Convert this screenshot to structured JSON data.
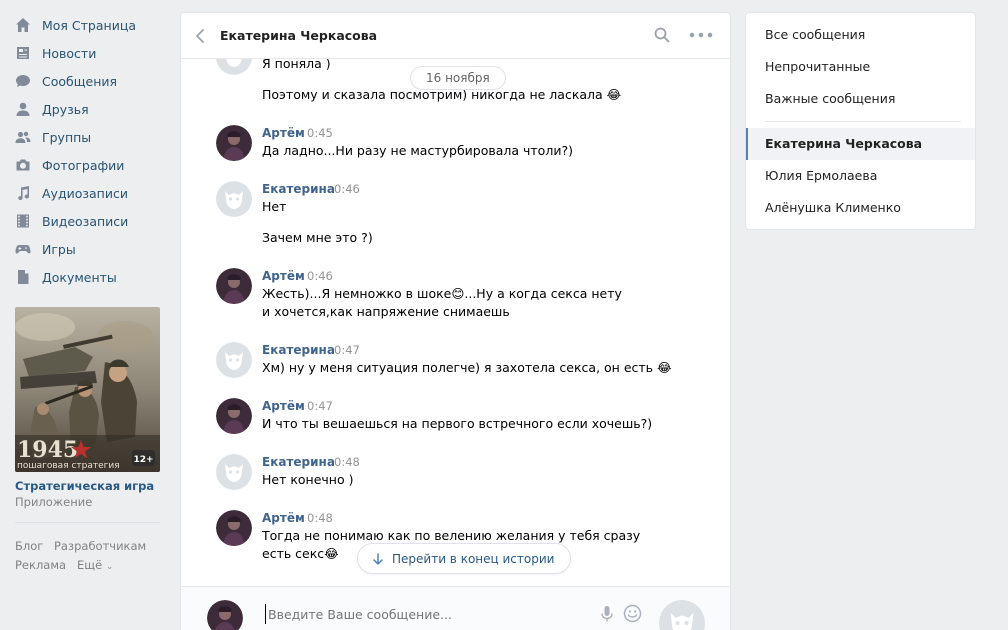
{
  "nav": {
    "items": [
      {
        "label": "Моя Страница",
        "icon": "home-icon"
      },
      {
        "label": "Новости",
        "icon": "news-icon"
      },
      {
        "label": "Сообщения",
        "icon": "messages-icon"
      },
      {
        "label": "Друзья",
        "icon": "friends-icon"
      },
      {
        "label": "Группы",
        "icon": "groups-icon"
      },
      {
        "label": "Фотографии",
        "icon": "camera-icon"
      },
      {
        "label": "Аудиозаписи",
        "icon": "music-icon"
      },
      {
        "label": "Видеозаписи",
        "icon": "video-icon"
      },
      {
        "label": "Игры",
        "icon": "gamepad-icon"
      },
      {
        "label": "Документы",
        "icon": "document-icon"
      }
    ]
  },
  "promo": {
    "game_title": "1945",
    "game_subtitle": "пошаговая стратегия",
    "age_badge": "12+",
    "title": "Стратегическая игра",
    "subtitle": "Приложение"
  },
  "footer": {
    "blog": "Блог",
    "developers": "Разработчикам",
    "ads": "Реклама",
    "more": "Ещё"
  },
  "chat": {
    "title": "Екатерина Черкасова",
    "date_pill": "16 ноября",
    "goto_end": "Перейти в конец истории",
    "input_placeholder": "Введите Ваше сообщение...",
    "messages": [
      {
        "text": "Я поняла )"
      },
      {
        "text": "Поэтому и сказала посмотрим) никогда не ласкала 😂"
      },
      {
        "author": "Артём",
        "time": "0:45",
        "text": "Да ладно...Ни разу не мастурбировала чтоли?)"
      },
      {
        "author": "Екатерина",
        "time": "0:46",
        "text": "Нет"
      },
      {
        "text": "Зачем мне это ?)"
      },
      {
        "author": "Артём",
        "time": "0:46",
        "text": "Жесть)...Я немножко в шоке😊...Ну а когда секса нету и хочется,как напряжение снимаешь"
      },
      {
        "author": "Екатерина",
        "time": "0:47",
        "text": "Хм) ну у меня ситуация полегче) я захотела секса, он есть 😂"
      },
      {
        "author": "Артём",
        "time": "0:47",
        "text": "И что ты вешаешься на первого встречного если хочешь?)"
      },
      {
        "author": "Екатерина",
        "time": "0:48",
        "text": "Нет конечно )"
      },
      {
        "author": "Артём",
        "time": "0:48",
        "text": "Тогда не понимаю как по велению желания у тебя сразу есть секс😂"
      }
    ]
  },
  "sidebar": {
    "filters": [
      "Все сообщения",
      "Непрочитанные",
      "Важные сообщения"
    ],
    "conversations": [
      "Екатерина Черкасова",
      "Юлия Ермолаева",
      "Алёнушка Клименко"
    ],
    "active_index": 0
  },
  "colors": {
    "link": "#2a5885",
    "author": "#42648b",
    "accent": "#5181b8",
    "icon": "#828a99",
    "background": "#edeef0"
  }
}
